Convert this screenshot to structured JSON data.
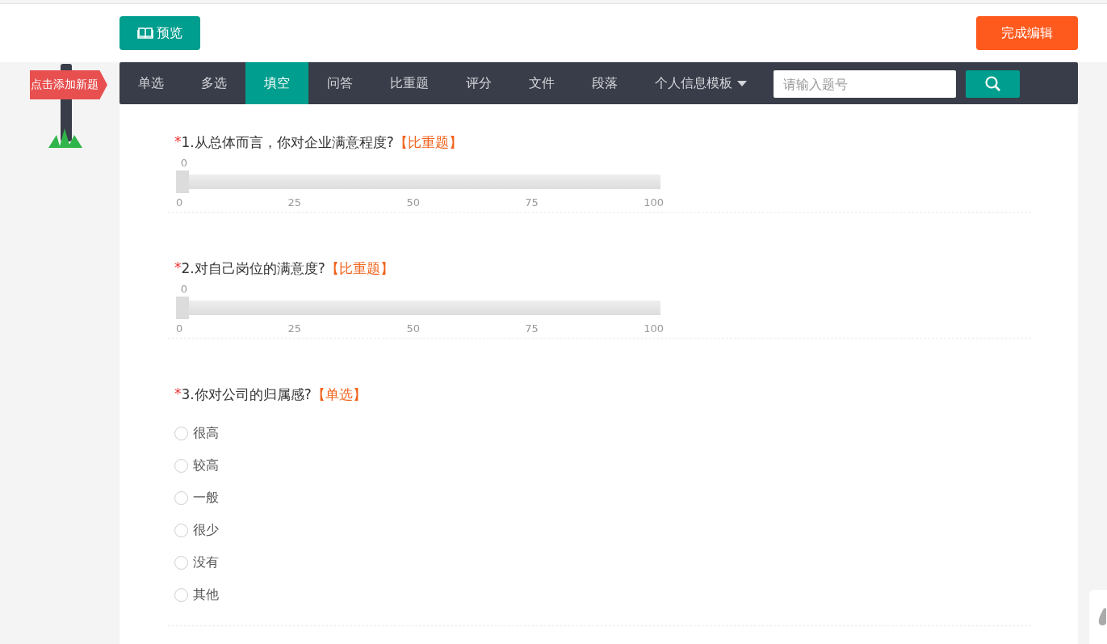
{
  "toolbar": {
    "preview_button": "预览",
    "finish_button": "完成编辑"
  },
  "signpost": {
    "label": "点击添加新题"
  },
  "question_types": [
    {
      "label": "单选",
      "selected": false,
      "dropdown": false
    },
    {
      "label": "多选",
      "selected": false,
      "dropdown": false
    },
    {
      "label": "填空",
      "selected": true,
      "dropdown": false
    },
    {
      "label": "问答",
      "selected": false,
      "dropdown": false
    },
    {
      "label": "比重题",
      "selected": false,
      "dropdown": false
    },
    {
      "label": "评分",
      "selected": false,
      "dropdown": false
    },
    {
      "label": "文件",
      "selected": false,
      "dropdown": false
    },
    {
      "label": "段落",
      "selected": false,
      "dropdown": false
    },
    {
      "label": "个人信息模板",
      "selected": false,
      "dropdown": true
    }
  ],
  "search": {
    "placeholder": "请输入题号"
  },
  "questions": [
    {
      "kind": "slider",
      "required_mark": "*",
      "title": "1.从总体而言，你对企业满意程度?",
      "type_tag": "【比重题】",
      "reading": "0",
      "level": 0,
      "ticks": [
        "0",
        "25",
        "50",
        "75",
        "100"
      ]
    },
    {
      "kind": "slider",
      "required_mark": "*",
      "title": "2.对自己岗位的满意度?",
      "type_tag": "【比重题】",
      "reading": "0",
      "level": 0,
      "ticks": [
        "0",
        "25",
        "50",
        "75",
        "100"
      ]
    },
    {
      "kind": "radio",
      "required_mark": "*",
      "title": "3.你对公司的归属感?",
      "type_tag": "【单选】",
      "options": [
        {
          "label": "很高",
          "selected": false
        },
        {
          "label": "较高",
          "selected": false
        },
        {
          "label": "一般",
          "selected": false
        },
        {
          "label": "很少",
          "selected": false
        },
        {
          "label": "没有",
          "selected": false
        },
        {
          "label": "其他",
          "selected": false
        }
      ]
    }
  ]
}
